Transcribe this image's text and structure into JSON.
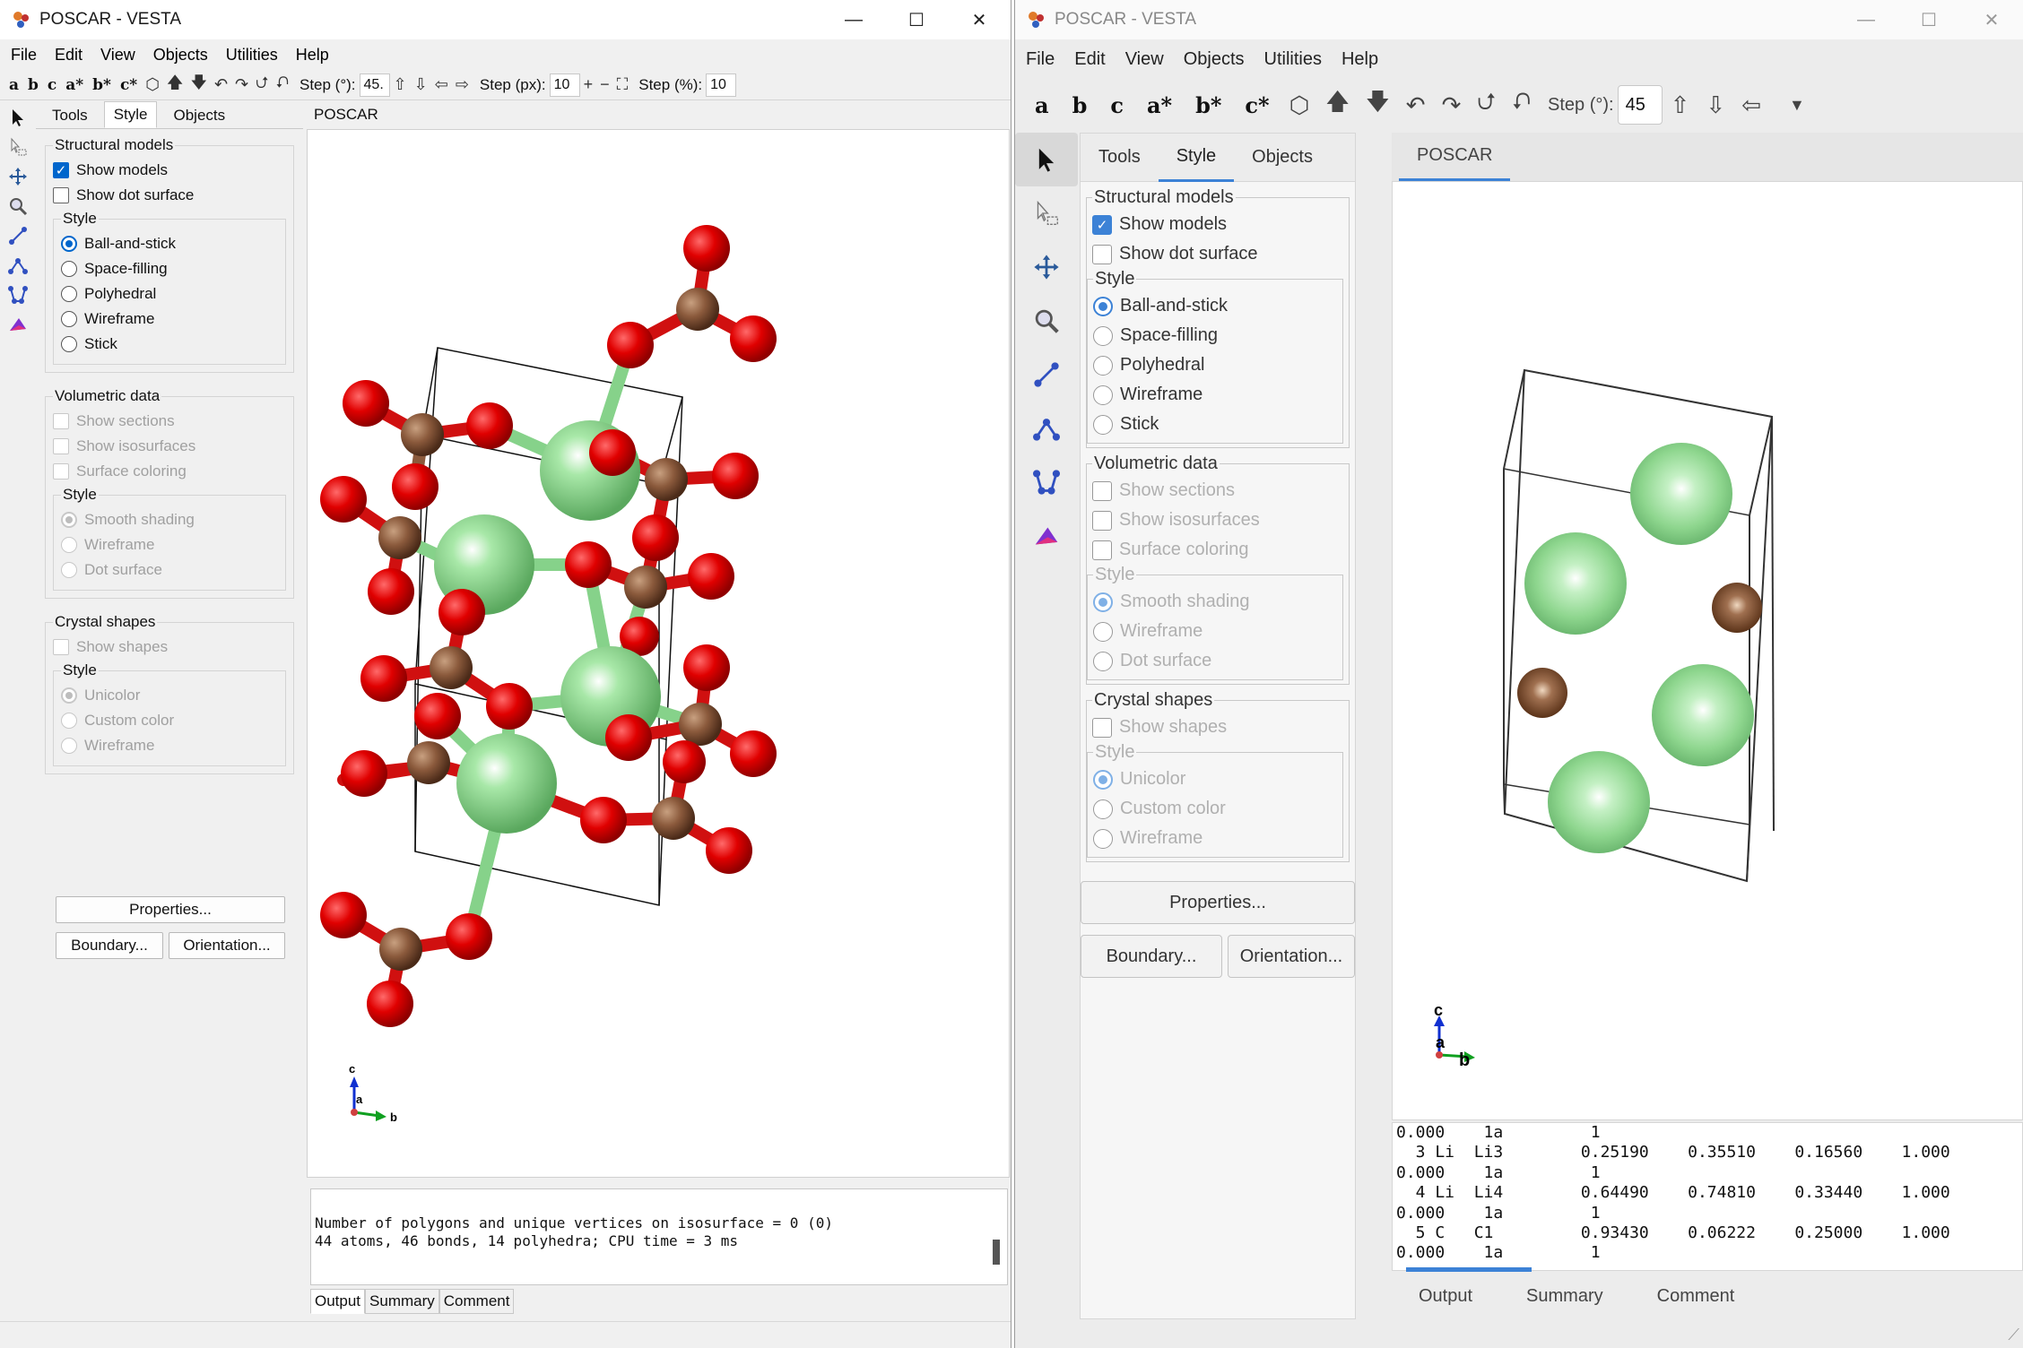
{
  "left": {
    "title": "POSCAR - VESTA",
    "window_controls": {
      "minimize": "—",
      "maximize": "☐",
      "close": "✕"
    },
    "menu": [
      "File",
      "Edit",
      "View",
      "Objects",
      "Utilities",
      "Help"
    ],
    "toolbar": {
      "axes": [
        "a",
        "b",
        "c",
        "a*",
        "b*",
        "c*"
      ],
      "step_deg_label": "Step (°):",
      "step_deg_value": "45.",
      "step_px_label": "Step (px):",
      "step_px_value": "10",
      "step_pct_label": "Step (%):",
      "step_pct_value": "10"
    },
    "panel_tabs": [
      "Tools",
      "Style",
      "Objects"
    ],
    "structural": {
      "legend": "Structural models",
      "show_models": "Show models",
      "show_dot_surface": "Show dot surface",
      "style_legend": "Style",
      "styles": [
        "Ball-and-stick",
        "Space-filling",
        "Polyhedral",
        "Wireframe",
        "Stick"
      ]
    },
    "volumetric": {
      "legend": "Volumetric data",
      "items": [
        "Show sections",
        "Show isosurfaces",
        "Surface coloring"
      ],
      "style_legend": "Style",
      "styles": [
        "Smooth shading",
        "Wireframe",
        "Dot surface"
      ]
    },
    "crystal": {
      "legend": "Crystal shapes",
      "show_shapes": "Show shapes",
      "style_legend": "Style",
      "styles": [
        "Unicolor",
        "Custom color",
        "Wireframe"
      ]
    },
    "buttons": {
      "properties": "Properties...",
      "boundary": "Boundary...",
      "orientation": "Orientation..."
    },
    "view_tab": "POSCAR",
    "axis_labels": {
      "c": "c",
      "a": "a",
      "b": "b"
    },
    "output_lines": [
      "Number of polygons and unique vertices on isosurface = 0 (0)",
      "44 atoms, 46 bonds, 14 polyhedra; CPU time = 3 ms"
    ],
    "output_tabs": [
      "Output",
      "Summary",
      "Comment"
    ]
  },
  "right": {
    "title": "POSCAR - VESTA",
    "window_controls": {
      "minimize": "—",
      "maximize": "☐",
      "close": "✕"
    },
    "menu": [
      "File",
      "Edit",
      "View",
      "Objects",
      "Utilities",
      "Help"
    ],
    "toolbar": {
      "axes": [
        "a",
        "b",
        "c",
        "a*",
        "b*",
        "c*"
      ],
      "step_deg_label": "Step (°):",
      "step_deg_value": "45"
    },
    "panel_tabs": [
      "Tools",
      "Style",
      "Objects"
    ],
    "structural": {
      "legend": "Structural models",
      "show_models": "Show models",
      "show_dot_surface": "Show dot surface",
      "style_legend": "Style",
      "styles": [
        "Ball-and-stick",
        "Space-filling",
        "Polyhedral",
        "Wireframe",
        "Stick"
      ]
    },
    "volumetric": {
      "legend": "Volumetric data",
      "items": [
        "Show sections",
        "Show isosurfaces",
        "Surface coloring"
      ],
      "style_legend": "Style",
      "styles": [
        "Smooth shading",
        "Wireframe",
        "Dot surface"
      ]
    },
    "crystal": {
      "legend": "Crystal shapes",
      "show_shapes": "Show shapes",
      "style_legend": "Style",
      "styles": [
        "Unicolor",
        "Custom color",
        "Wireframe"
      ]
    },
    "buttons": {
      "properties": "Properties...",
      "boundary": "Boundary...",
      "orientation": "Orientation..."
    },
    "view_tab": "POSCAR",
    "axis_labels": {
      "c": "c",
      "a": "a",
      "b": "b"
    },
    "output_text": "0.000    1a         1\n  3 Li  Li3        0.25190    0.35510    0.16560    1.000\n0.000    1a         1\n  4 Li  Li4        0.64490    0.74810    0.33440    1.000\n0.000    1a         1\n  5 C   C1         0.93430    0.06222    0.25000    1.000\n0.000    1a         1",
    "output_tabs": [
      "Output",
      "Summary",
      "Comment"
    ]
  },
  "colors": {
    "oxygen": "#e00000",
    "carbon": "#8b5a3c",
    "lithium": "#86d28a",
    "accent": "#3c82d6"
  }
}
